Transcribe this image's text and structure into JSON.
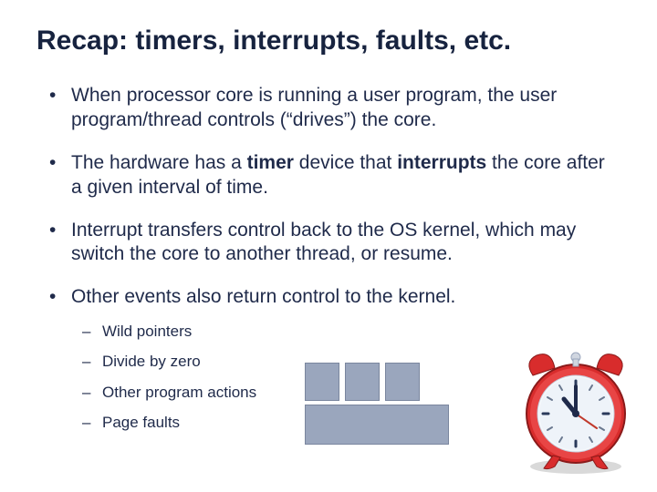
{
  "title": "Recap: timers, interrupts, faults, etc.",
  "bullets": {
    "b1": "When processor core is running a user program, the user program/thread controls (“drives”) the core.",
    "b2_a": "The hardware has a ",
    "b2_b": "timer",
    "b2_c": " device that ",
    "b2_d": "interrupts",
    "b2_e": " the core after a given interval of time.",
    "b3": "Interrupt transfers control back to the OS kernel, which may switch the core to another thread, or resume.",
    "b4": "Other events also return control to the kernel."
  },
  "subs": {
    "s1": "Wild pointers",
    "s2": "Divide by zero",
    "s3": "Other program actions",
    "s4": "Page faults"
  }
}
